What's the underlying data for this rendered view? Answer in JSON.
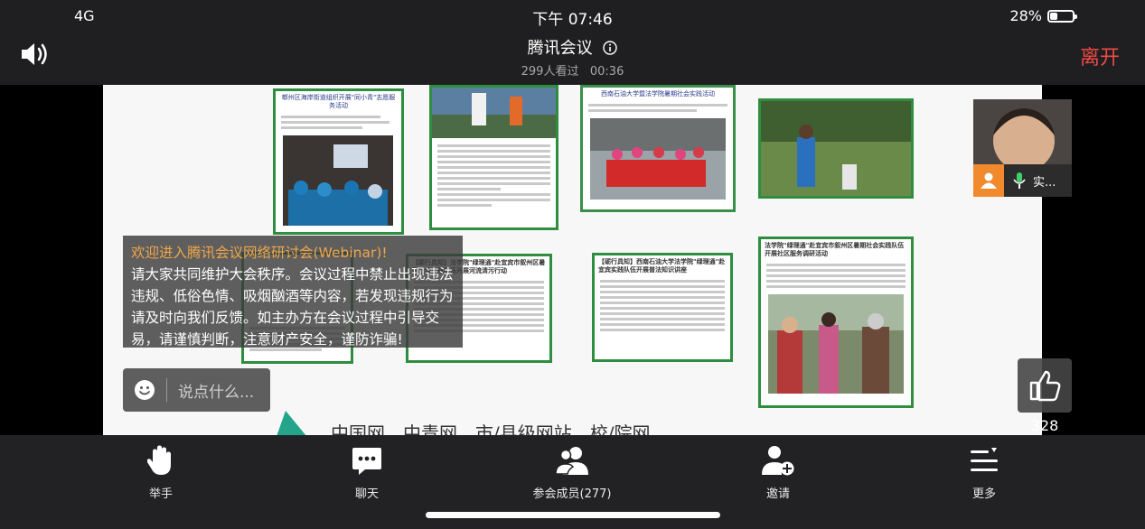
{
  "status_bar": {
    "carrier": "4G",
    "time": "下午 07:46",
    "battery": "28%"
  },
  "header": {
    "title": "腾讯会议",
    "viewers": "299人看过",
    "duration": "00:36",
    "leave_label": "离开"
  },
  "notice": {
    "title": "欢迎进入腾讯会议网络研讨会(Webinar)!",
    "body": "请大家共同维护大会秩序。会议过程中禁止出现违法违规、低俗色情、吸烟酗酒等内容，若发现违规行为请及时向我们反馈。如主办方在会议过程中引导交易，请谨慎判断，注意财产安全，谨防诈骗!"
  },
  "chat_input": {
    "placeholder": "说点什么..."
  },
  "slide": {
    "bottom_text": "中国网、中青网、市/县级网站、校/院网",
    "docs": [
      {
        "heading": "郫州区海岸街道组织开展\"同小青\"志愿服务活动"
      },
      {
        "heading": ""
      },
      {
        "heading": "西南石油大学暨法学院暑期社会实践活动"
      },
      {
        "heading": ""
      },
      {
        "heading": "【砺行具知】法学院\"绿理通\"赴宜宾市叙州区暑期社会实践队伍开展河流清污行动"
      },
      {
        "heading": "【砺行具知】西南石油大学法学院\"绿理通\"赴宜宾实践队伍开展普法知识讲座"
      },
      {
        "heading": "法学院\"绿理通\"赴宜宾市叙州区暑期社会实践队伍开展社区服务调研活动"
      }
    ]
  },
  "video_tile": {
    "name": "实..."
  },
  "like": {
    "count": "328"
  },
  "toolbar": {
    "raise_hand": "举手",
    "chat": "聊天",
    "members": "参会成员(277)",
    "invite": "邀请",
    "more": "更多"
  },
  "colors": {
    "leave": "#ef4a45",
    "notice_title": "#f0a64a",
    "doc_border": "#2f8d3f",
    "avatar_badge": "#f08a2d"
  }
}
